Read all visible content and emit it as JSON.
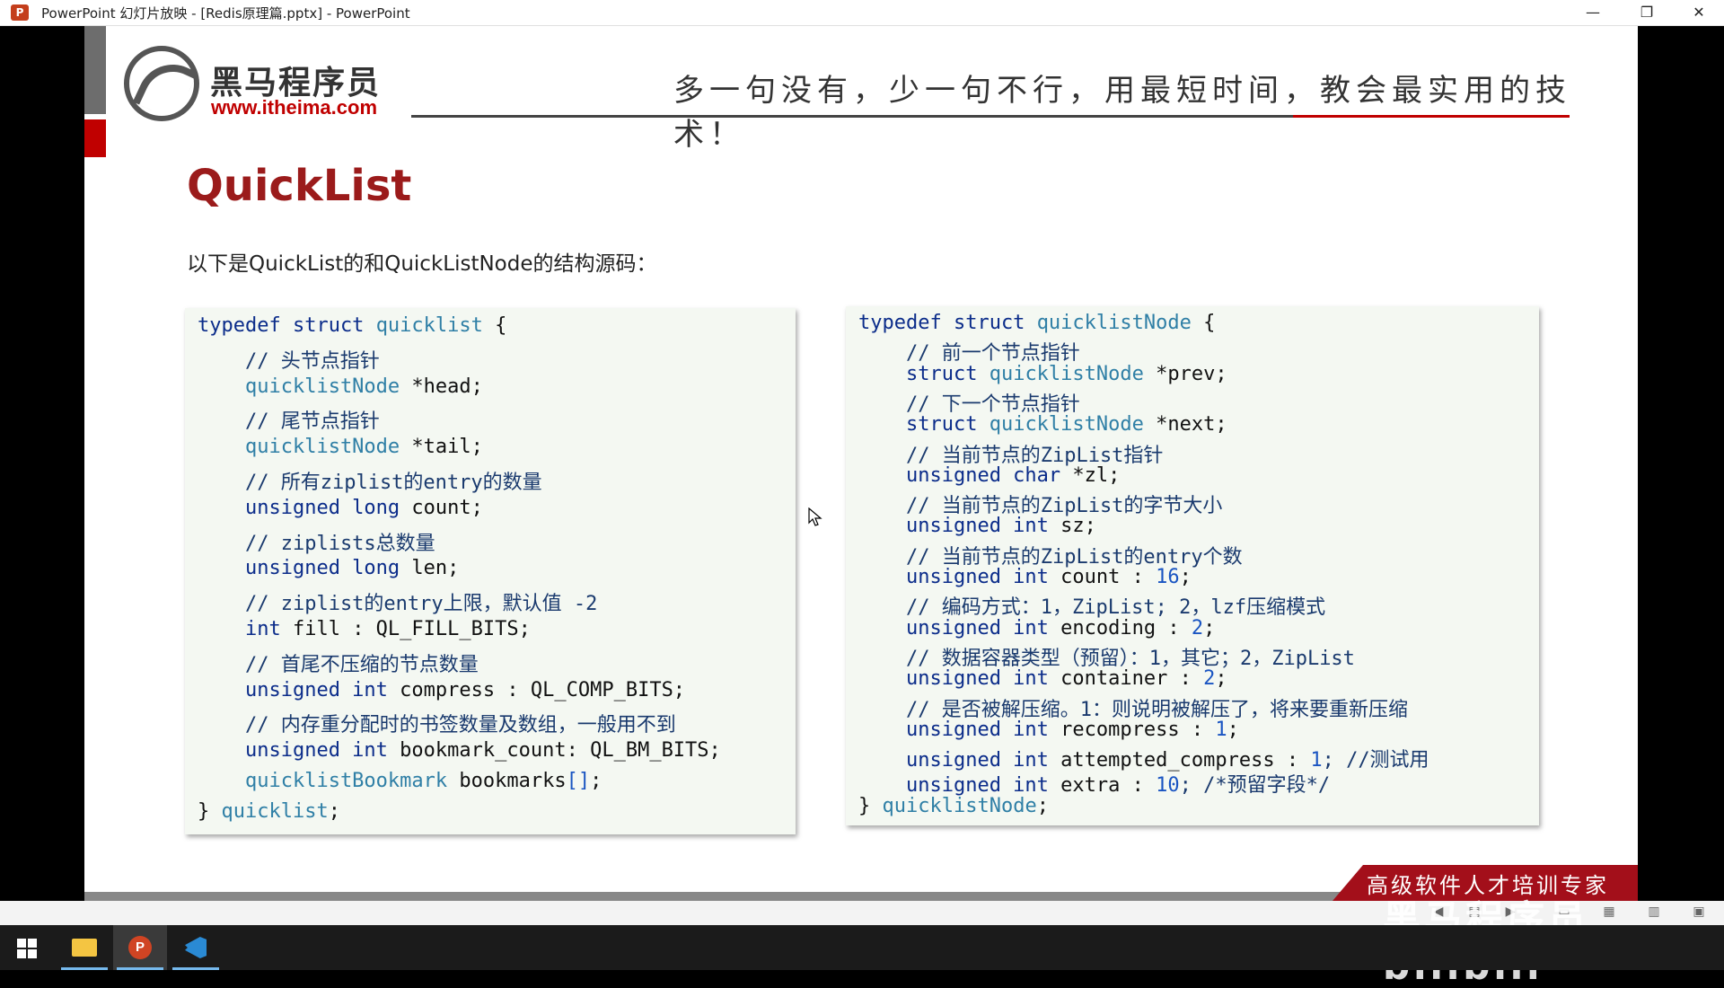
{
  "window": {
    "title": "PowerPoint 幻灯片放映 - [Redis原理篇.pptx] - PowerPoint",
    "minimize": "—",
    "restore": "❐",
    "close": "✕",
    "app_icon_letter": "P"
  },
  "slide": {
    "logo_name": "黑马程序员",
    "logo_url": "www.itheima.com",
    "slogan": "多一句没有，少一句不行，用最短时间，教会最实用的技术！",
    "title": "QuickList",
    "subtitle": "以下是QuickList的和QuickListNode的结构源码：",
    "footer_badge": "高级软件人才培训专家",
    "left_code": [
      [
        {
          "t": "typedef struct ",
          "c": "k"
        },
        {
          "t": "quicklist",
          "c": "t"
        },
        {
          "t": " {",
          "c": "p"
        }
      ],
      [
        {
          "t": "    // 头节点指针",
          "c": "c"
        }
      ],
      [
        {
          "t": "    quicklistNode",
          "c": "t"
        },
        {
          "t": " *head;",
          "c": "p"
        }
      ],
      [
        {
          "t": "    // 尾节点指针",
          "c": "c"
        }
      ],
      [
        {
          "t": "    quicklistNode",
          "c": "t"
        },
        {
          "t": " *tail;",
          "c": "p"
        }
      ],
      [
        {
          "t": "    // 所有ziplist的entry的数量",
          "c": "c"
        }
      ],
      [
        {
          "t": "    unsigned long ",
          "c": "k"
        },
        {
          "t": "count;",
          "c": "p"
        }
      ],
      [
        {
          "t": "    // ziplists总数量",
          "c": "c"
        }
      ],
      [
        {
          "t": "    unsigned long ",
          "c": "k"
        },
        {
          "t": "len;",
          "c": "p"
        }
      ],
      [
        {
          "t": "    // ziplist的entry上限，默认值 -2",
          "c": "c"
        }
      ],
      [
        {
          "t": "    int ",
          "c": "k"
        },
        {
          "t": "fill : QL_FILL_BITS;",
          "c": "p"
        }
      ],
      [
        {
          "t": "    // 首尾不压缩的节点数量",
          "c": "c"
        }
      ],
      [
        {
          "t": "    unsigned int ",
          "c": "k"
        },
        {
          "t": "compress : QL_COMP_BITS;",
          "c": "p"
        }
      ],
      [
        {
          "t": "    // 内存重分配时的书签数量及数组，一般用不到",
          "c": "c"
        }
      ],
      [
        {
          "t": "    unsigned int ",
          "c": "k"
        },
        {
          "t": "bookmark_count: QL_BM_BITS;",
          "c": "p"
        }
      ],
      [
        {
          "t": "    quicklistBookmark",
          "c": "t"
        },
        {
          "t": " bookmarks",
          "c": "p"
        },
        {
          "t": "[]",
          "c": "n"
        },
        {
          "t": ";",
          "c": "p"
        }
      ],
      [
        {
          "t": "} ",
          "c": "p"
        },
        {
          "t": "quicklist",
          "c": "t"
        },
        {
          "t": ";",
          "c": "p"
        }
      ]
    ],
    "right_code": [
      [
        {
          "t": "typedef struct ",
          "c": "k"
        },
        {
          "t": "quicklistNode",
          "c": "t"
        },
        {
          "t": " {",
          "c": "p"
        }
      ],
      [
        {
          "t": "    // 前一个节点指针",
          "c": "c"
        }
      ],
      [
        {
          "t": "    struct ",
          "c": "k"
        },
        {
          "t": "quicklistNode",
          "c": "t"
        },
        {
          "t": " *prev;",
          "c": "p"
        }
      ],
      [
        {
          "t": "    // 下一个节点指针",
          "c": "c"
        }
      ],
      [
        {
          "t": "    struct ",
          "c": "k"
        },
        {
          "t": "quicklistNode",
          "c": "t"
        },
        {
          "t": " *next;",
          "c": "p"
        }
      ],
      [
        {
          "t": "    // 当前节点的ZipList指针",
          "c": "c"
        }
      ],
      [
        {
          "t": "    unsigned char ",
          "c": "k"
        },
        {
          "t": "*zl;",
          "c": "p"
        }
      ],
      [
        {
          "t": "    // 当前节点的ZipList的字节大小",
          "c": "c"
        }
      ],
      [
        {
          "t": "    unsigned int ",
          "c": "k"
        },
        {
          "t": "sz;",
          "c": "p"
        }
      ],
      [
        {
          "t": "    // 当前节点的ZipList的entry个数",
          "c": "c"
        }
      ],
      [
        {
          "t": "    unsigned int ",
          "c": "k"
        },
        {
          "t": "count : ",
          "c": "p"
        },
        {
          "t": "16",
          "c": "n"
        },
        {
          "t": ";",
          "c": "p"
        }
      ],
      [
        {
          "t": "    // 编码方式：1，ZipList; 2，lzf压缩模式",
          "c": "c"
        }
      ],
      [
        {
          "t": "    unsigned int ",
          "c": "k"
        },
        {
          "t": "encoding : ",
          "c": "p"
        },
        {
          "t": "2",
          "c": "n"
        },
        {
          "t": ";",
          "c": "p"
        }
      ],
      [
        {
          "t": "    // 数据容器类型（预留）：1，其它；2，ZipList",
          "c": "c"
        }
      ],
      [
        {
          "t": "    unsigned int ",
          "c": "k"
        },
        {
          "t": "container : ",
          "c": "p"
        },
        {
          "t": "2",
          "c": "n"
        },
        {
          "t": ";",
          "c": "p"
        }
      ],
      [
        {
          "t": "    // 是否被解压缩。1：则说明被解压了，将来要重新压缩",
          "c": "c"
        }
      ],
      [
        {
          "t": "    unsigned int ",
          "c": "k"
        },
        {
          "t": "recompress : ",
          "c": "p"
        },
        {
          "t": "1",
          "c": "n"
        },
        {
          "t": ";",
          "c": "p"
        }
      ],
      [
        {
          "t": "    unsigned int ",
          "c": "k"
        },
        {
          "t": "attempted_compress : ",
          "c": "p"
        },
        {
          "t": "1",
          "c": "n"
        },
        {
          "t": "; //测试用",
          "c": "c"
        }
      ],
      [
        {
          "t": "    unsigned int ",
          "c": "k"
        },
        {
          "t": "extra : ",
          "c": "p"
        },
        {
          "t": "10",
          "c": "n"
        },
        {
          "t": "; /*预留字段*/",
          "c": "c"
        }
      ],
      [
        {
          "t": "} ",
          "c": "p"
        },
        {
          "t": "quicklistNode",
          "c": "t"
        },
        {
          "t": ";",
          "c": "p"
        }
      ]
    ]
  },
  "overlay": {
    "watermark": "黑马程序员 bilibili"
  },
  "taskbar": {
    "items": [
      "start-button",
      "file-explorer",
      "powerpoint",
      "vscode"
    ]
  }
}
